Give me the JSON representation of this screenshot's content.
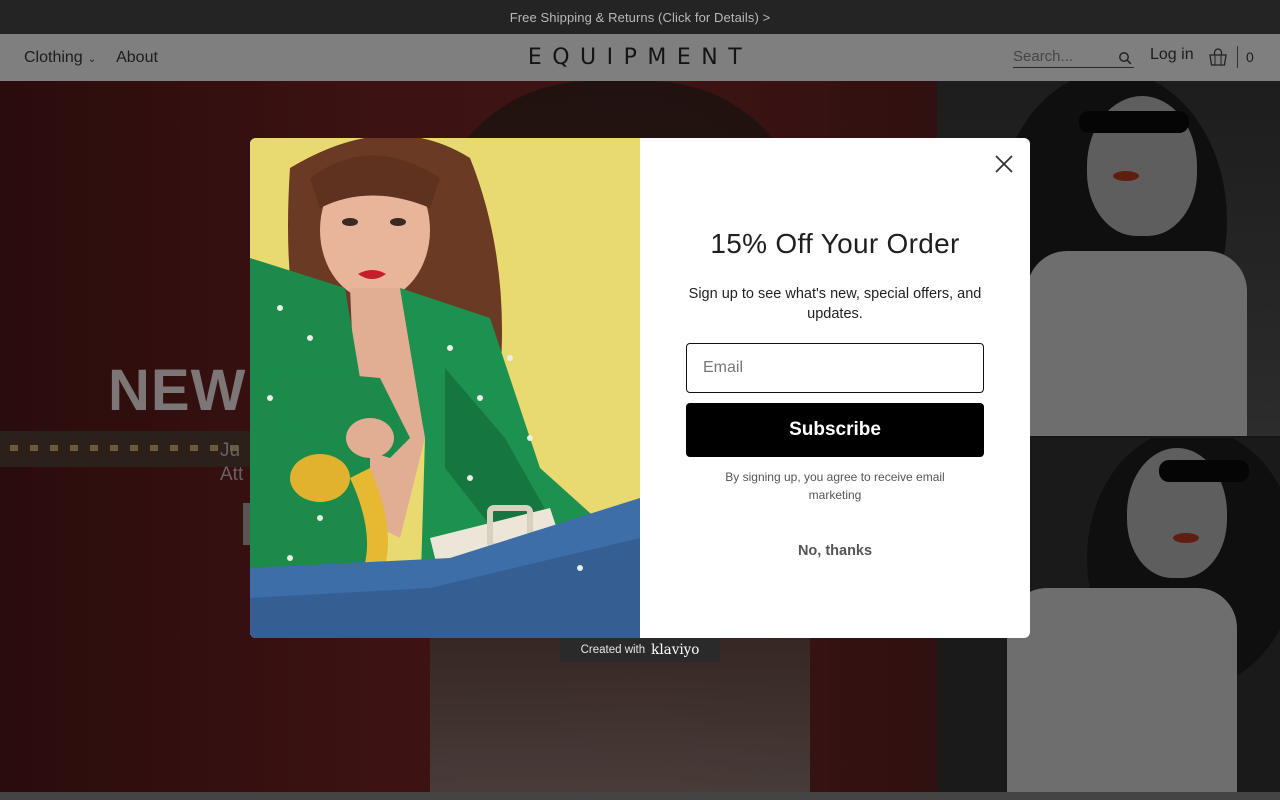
{
  "announcement": {
    "text": "Free Shipping & Returns (Click for Details) >"
  },
  "header": {
    "nav": [
      {
        "label": "Clothing",
        "has_dropdown": true
      },
      {
        "label": "About",
        "has_dropdown": false
      }
    ],
    "logo": "EQUIPMENT",
    "search_placeholder": "Search...",
    "login_label": "Log in",
    "cart_count": "0"
  },
  "hero": {
    "title": "NEW",
    "subtitle_line1": "Ju",
    "subtitle_line2": "Att"
  },
  "modal": {
    "title": "15% Off Your Order",
    "description": "Sign up to see what's new, special offers, and updates.",
    "email_placeholder": "Email",
    "subscribe_label": "Subscribe",
    "legal": "By signing up, you agree to receive email marketing",
    "dismiss_label": "No, thanks"
  },
  "badge": {
    "prefix": "Created with",
    "brand": "klaviyo"
  },
  "colors": {
    "accent": "#000000",
    "modal_bg": "#ffffff",
    "header_dimmed": "#7f7f7f",
    "announce_bg": "#242424"
  }
}
